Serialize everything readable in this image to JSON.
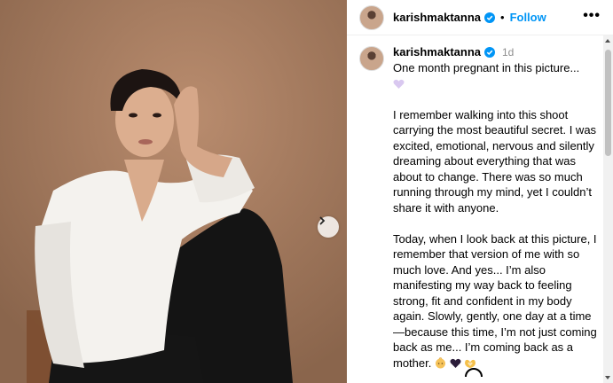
{
  "post": {
    "image": {
      "name": "woman-in-white-shirt-photo",
      "next_icon": "chevron-right-icon"
    },
    "header": {
      "username": "karishmaktanna",
      "verified_icon": "verified-badge-icon",
      "separator": "•",
      "follow_label": "Follow",
      "more_label": "•••"
    },
    "caption": {
      "username": "karishmaktanna",
      "time": "1d",
      "paragraphs": [
        "One month pregnant in this picture...",
        "I remember walking into this shoot carrying the most beautiful secret. I was excited, emotional, nervous and silently dreaming about everything that was about to change. There was so much running through my mind, yet I couldn’t share it with anyone.",
        "Today, when I look back at this picture, I remember that version of me with so much love. And yes... I’m also manifesting my way back to feeling strong, fit and confident in my body again. Slowly, gently, one day at a time—because this time, I’m not just coming back as me... I’m coming back as a mother."
      ],
      "emojis_line1": [
        "light-purple-heart-emoji"
      ],
      "emojis_end": [
        "baby-emoji",
        "black-heart-emoji",
        "heart-hands-emoji"
      ]
    }
  },
  "colors": {
    "link_blue": "#0095f6",
    "muted_gray": "#8e8e8e",
    "verified_blue": "#0095f6"
  }
}
